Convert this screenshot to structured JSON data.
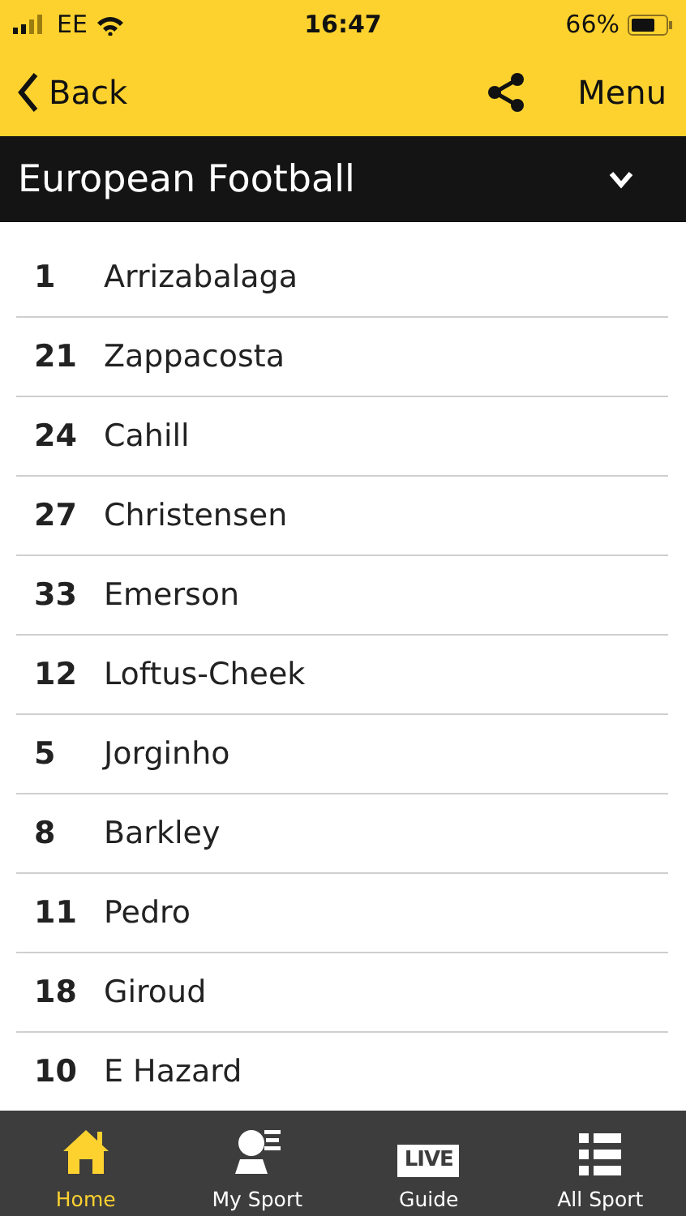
{
  "status_bar": {
    "carrier": "EE",
    "time": "16:47",
    "battery": "66%"
  },
  "nav": {
    "back": "Back",
    "menu": "Menu"
  },
  "section": {
    "title": "European Football",
    "expanded": false
  },
  "players": [
    {
      "number": "1",
      "name": "Arrizabalaga"
    },
    {
      "number": "21",
      "name": "Zappacosta"
    },
    {
      "number": "24",
      "name": "Cahill"
    },
    {
      "number": "27",
      "name": "Christensen"
    },
    {
      "number": "33",
      "name": "Emerson"
    },
    {
      "number": "12",
      "name": "Loftus-Cheek"
    },
    {
      "number": "5",
      "name": "Jorginho"
    },
    {
      "number": "8",
      "name": "Barkley"
    },
    {
      "number": "11",
      "name": "Pedro"
    },
    {
      "number": "18",
      "name": "Giroud"
    },
    {
      "number": "10",
      "name": "E Hazard"
    }
  ],
  "tab_bar": [
    {
      "kind": "home",
      "label": "Home",
      "selected": true
    },
    {
      "kind": "mysport",
      "label": "My Sport",
      "selected": false
    },
    {
      "kind": "live",
      "label": "Guide",
      "selected": false,
      "icon_text": "LIVE"
    },
    {
      "kind": "list",
      "label": "All Sport",
      "selected": false
    }
  ]
}
